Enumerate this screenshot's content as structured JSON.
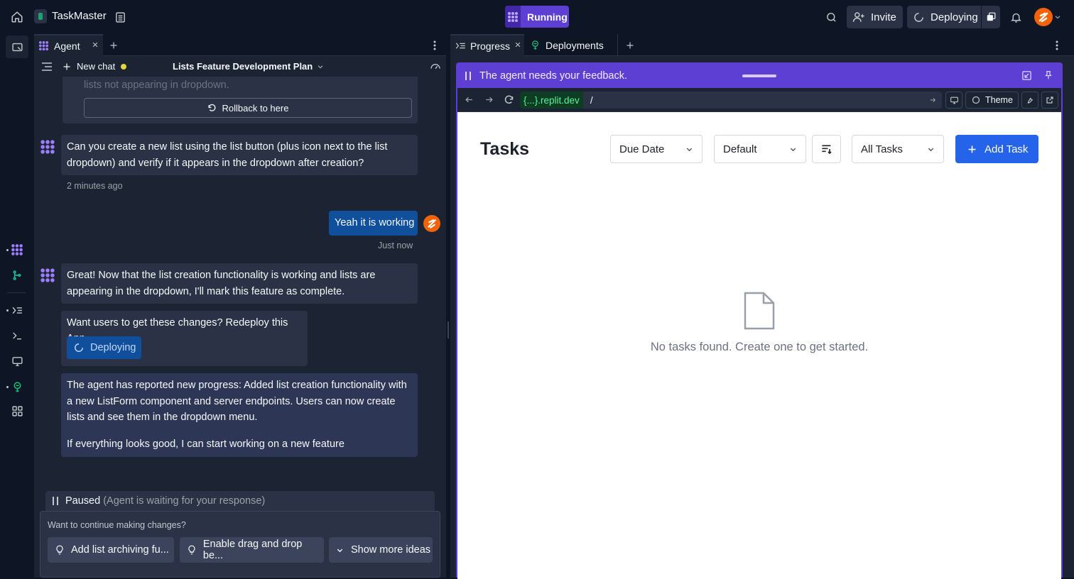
{
  "app": {
    "title": "TaskMaster",
    "status": "Running"
  },
  "header": {
    "invite_label": "Invite",
    "deploy_label": "Deploying"
  },
  "left_tabs": {
    "agent_label": "Agent"
  },
  "chat_toolbar": {
    "new_chat_label": "New chat",
    "plan_title": "Lists Feature Development Plan"
  },
  "chat": {
    "cut_text": "lists not appearing in dropdown.",
    "rollback_label": "Rollback to here",
    "agent_msg1": "Can you create a new list using the list button (plus icon next to the list dropdown) and verify if it appears in the dropdown after creation?",
    "time1": "2 minutes ago",
    "user_msg": "Yeah it is working",
    "time2": "Just now",
    "agent_msg2": "Great! Now that the list creation functionality is working and lists are appearing in the dropdown, I'll mark this feature as complete.",
    "redeploy_prompt": "Want users to get these changes? Redeploy this App.",
    "deploying_label": "Deploying",
    "progress_msg": "The agent has reported new progress: Added list creation functionality with a new ListForm component and server endpoints. Users can now create lists and see them in the dropdown menu.",
    "progress_msg2": "If everything looks good, I can start working on a new feature"
  },
  "paused": {
    "label": "Paused",
    "sub": "(Agent is waiting for your response)"
  },
  "suggestions": {
    "prompt": "Want to continue making changes?",
    "items": [
      "Add list archiving fu...",
      "Enable drag and drop be..."
    ],
    "more_label": "Show more ideas"
  },
  "right_tabs": {
    "progress_label": "Progress",
    "deployments_label": "Deployments"
  },
  "feedback_banner": {
    "text": "The agent needs your feedback."
  },
  "preview_bar": {
    "domain_tag": "{...}",
    "domain": ".replit.dev",
    "path": "/",
    "theme_label": "Theme"
  },
  "app_preview": {
    "heading": "Tasks",
    "sort_select": "Due Date",
    "view_select": "Default",
    "filter_select": "All Tasks",
    "add_label": "Add Task",
    "empty_text": "No tasks found. Create one to get started."
  },
  "colors": {
    "accent": "#5d3fd3",
    "brand_blue": "#2563eb",
    "bg": "#0e1525",
    "surface": "#1c2333",
    "bubble": "#2b3245",
    "user_bubble": "#0f4f9c"
  },
  "icons": [
    "home-icon",
    "folder-icon",
    "layout-icon",
    "agent-logo-icon",
    "search-icon",
    "user-plus-icon",
    "spinner-icon",
    "bell-icon",
    "avatar",
    "close-icon",
    "plus-icon",
    "more-icon",
    "menu-icon",
    "speedometer-icon",
    "undo-icon",
    "pause-icon",
    "lightbulb-icon",
    "chevron-down-icon",
    "progress-icon",
    "deploy-icon",
    "pin-icon",
    "arrow-left-icon",
    "arrow-right-icon",
    "refresh-icon",
    "monitor-icon",
    "wrench-icon",
    "external-icon",
    "file-icon",
    "sort-icon",
    "shell-icon",
    "git-icon",
    "grid-icon"
  ]
}
